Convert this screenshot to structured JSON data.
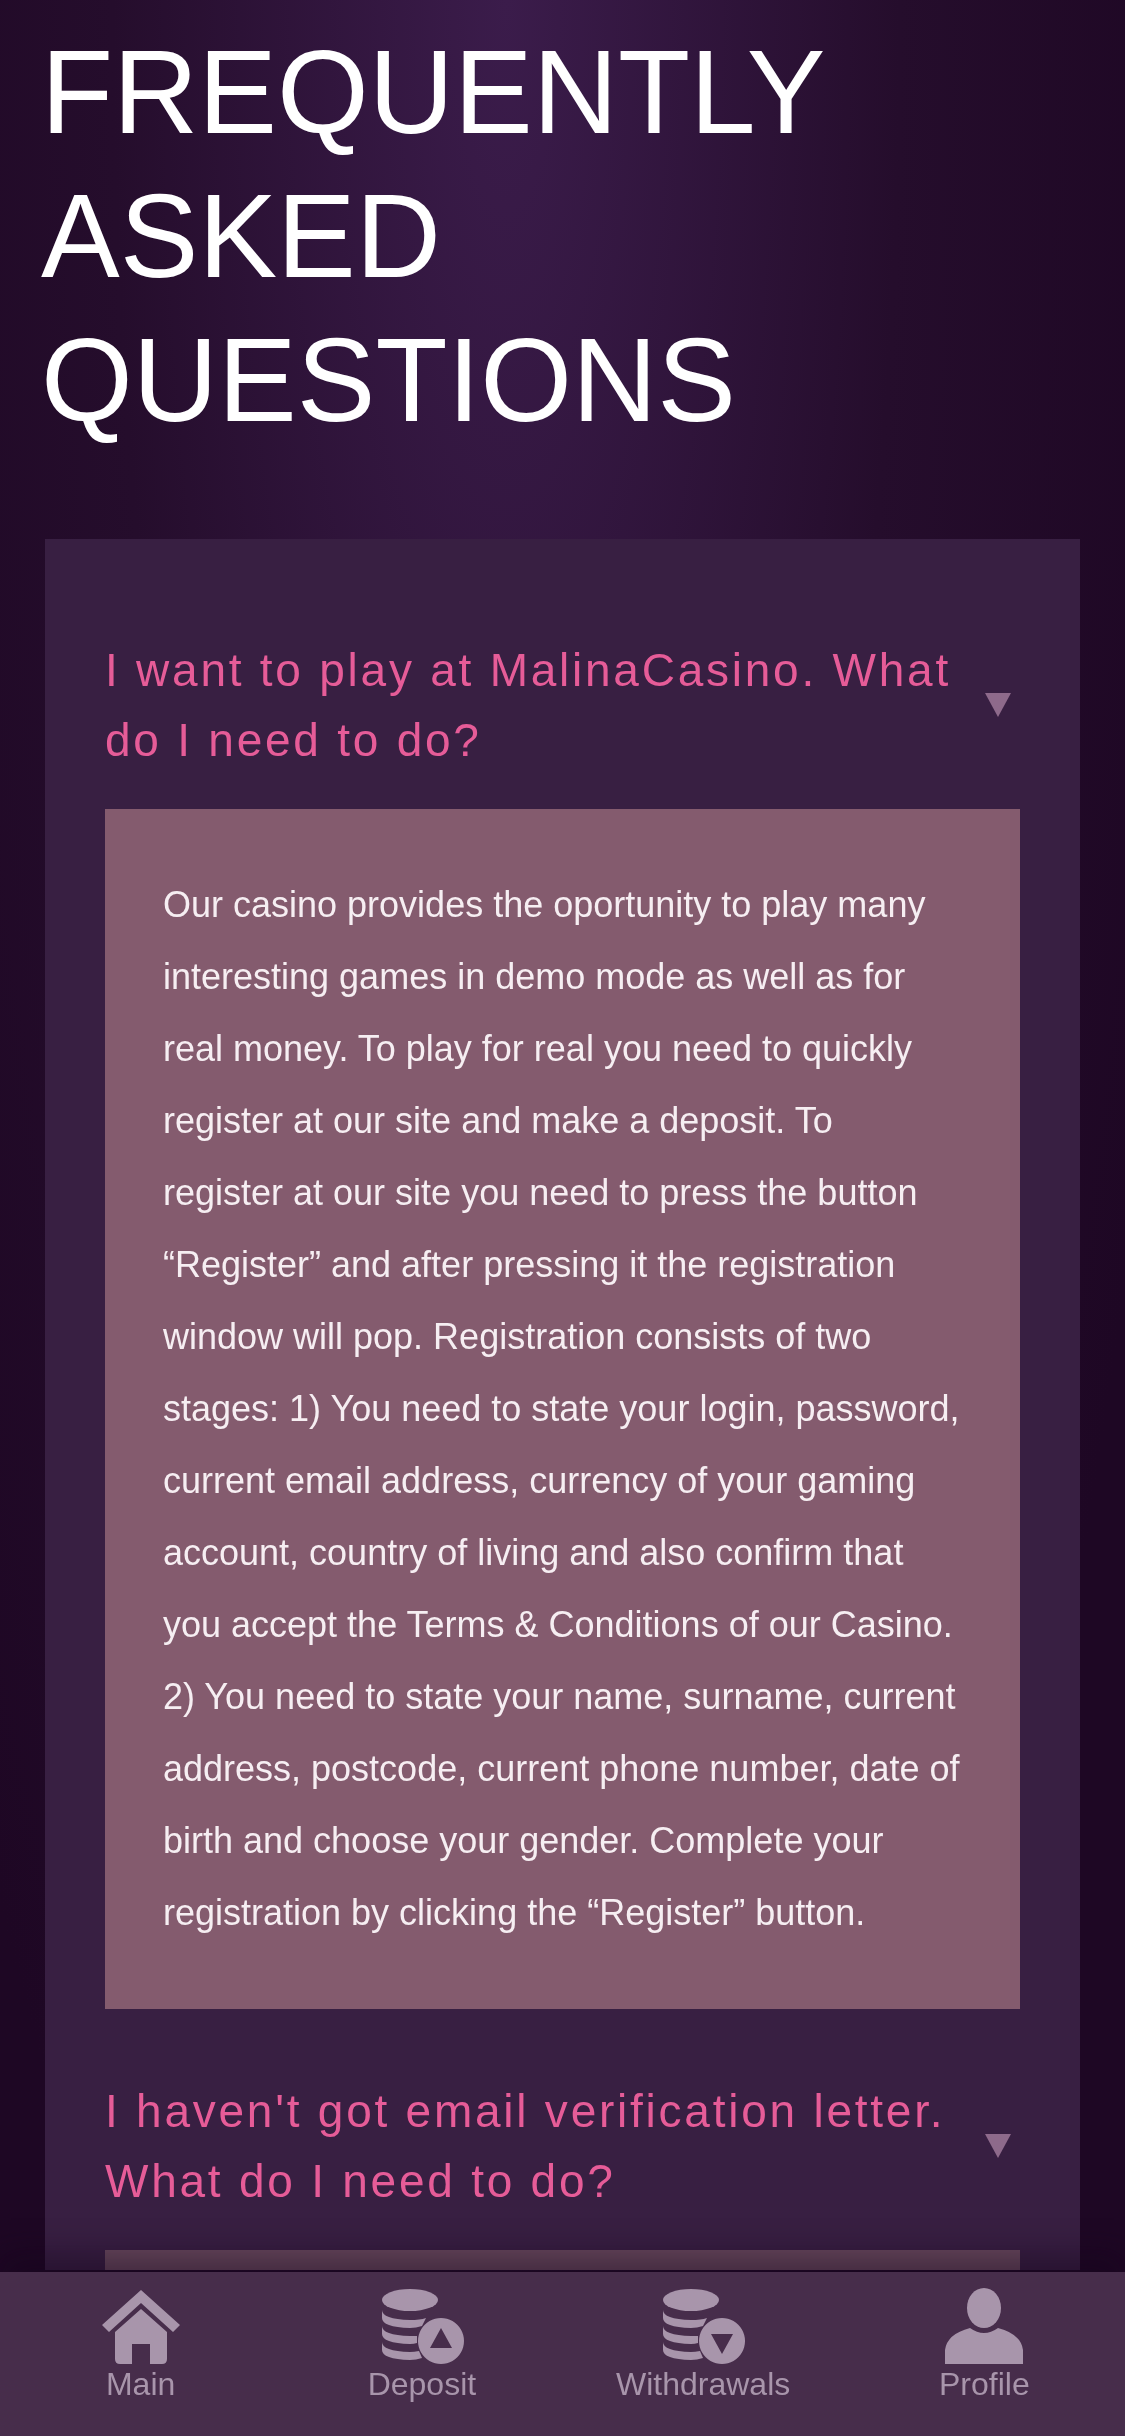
{
  "title": "FREQUENTLY ASKED QUESTIONS",
  "faq": [
    {
      "question": "I want to play at MalinaCasino. What do I need to do?",
      "expanded": true,
      "answer": "Our casino provides the oportunity to play many interesting games in demo mode as well as for real money. To play for real you need to quickly register at our site and make a deposit. To register at our site you need to press the button “Register” and after pressing it the registration window will pop. Registration consists of two stages: 1) You need to state your login, password, current email address, currency of your gaming account, country of living and also confirm that you accept the Terms & Conditions of our Casino. 2) You need to state your name, surname, current address, postcode, current phone number, date of birth and choose your gender. Complete your registration by clicking the “Register” button."
    },
    {
      "question": "I haven't got email verification letter. What do I need to do?",
      "expanded": true
    }
  ],
  "bottom_nav": [
    {
      "label": "Main",
      "selected": false
    },
    {
      "label": "Deposit",
      "selected": false
    },
    {
      "label": "Withdrawals",
      "selected": false
    },
    {
      "label": "Profile",
      "selected": false
    }
  ]
}
